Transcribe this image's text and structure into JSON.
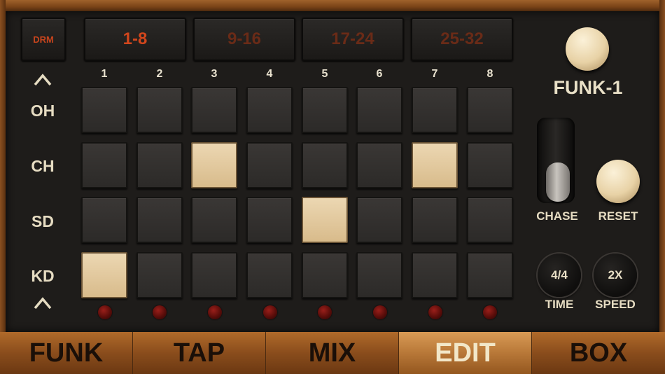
{
  "drm_button": {
    "label": "DRM"
  },
  "page_tabs": [
    {
      "label": "1-8",
      "active": true
    },
    {
      "label": "9-16",
      "active": false
    },
    {
      "label": "17-24",
      "active": false
    },
    {
      "label": "25-32",
      "active": false
    }
  ],
  "step_numbers": [
    "1",
    "2",
    "3",
    "4",
    "5",
    "6",
    "7",
    "8"
  ],
  "rows": [
    {
      "label": "OH",
      "steps": [
        false,
        false,
        false,
        false,
        false,
        false,
        false,
        false
      ]
    },
    {
      "label": "CH",
      "steps": [
        false,
        false,
        true,
        false,
        false,
        false,
        true,
        false
      ]
    },
    {
      "label": "SD",
      "steps": [
        false,
        false,
        false,
        false,
        true,
        false,
        false,
        false
      ]
    },
    {
      "label": "KD",
      "steps": [
        true,
        false,
        false,
        false,
        false,
        false,
        false,
        false
      ]
    }
  ],
  "scroll_up_icon": "chevron-up-icon",
  "scroll_down_icon": "chevron-up-icon",
  "preset": {
    "name": "FUNK-1"
  },
  "controls": {
    "chase_label": "CHASE",
    "reset_label": "RESET",
    "time_value": "4/4",
    "time_label": "TIME",
    "speed_value": "2X",
    "speed_label": "SPEED"
  },
  "bottom_tabs": [
    {
      "label": "FUNK",
      "active": false
    },
    {
      "label": "TAP",
      "active": false
    },
    {
      "label": "MIX",
      "active": false
    },
    {
      "label": "EDIT",
      "active": true
    },
    {
      "label": "BOX",
      "active": false
    }
  ],
  "colors": {
    "active_page_text": "#d2461c",
    "inactive_page_text": "#6a2b17",
    "pad_on": "#e4caa0",
    "pad_off": "#33302e",
    "led": "#7a1612"
  }
}
